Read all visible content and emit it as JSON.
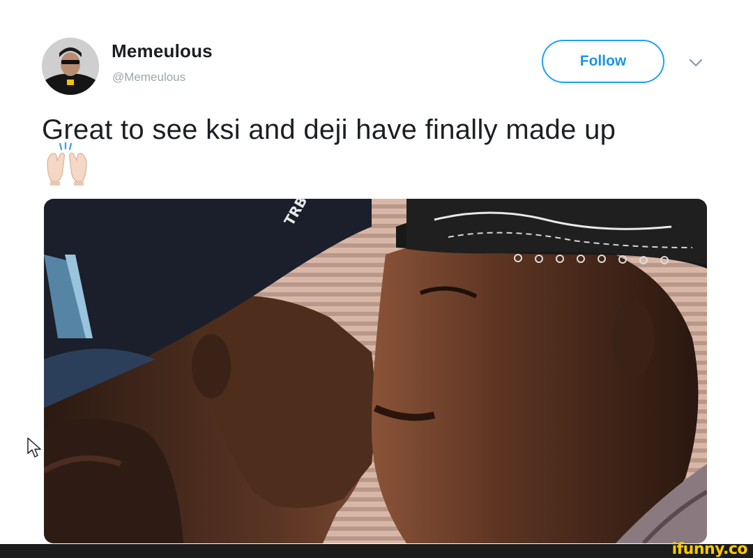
{
  "tweet": {
    "display_name": "Memeulous",
    "handle": "@Memeulous",
    "follow_label": "Follow",
    "text": "Great to see ksi and deji have finally made up",
    "emoji_name": "raising-hands-icon"
  },
  "media": {
    "description_icon": "photo",
    "cap_text": "TRB"
  },
  "watermark": {
    "text": "ifunny.co"
  },
  "colors": {
    "accent": "#1da1f2",
    "watermark": "#ffcc00"
  }
}
